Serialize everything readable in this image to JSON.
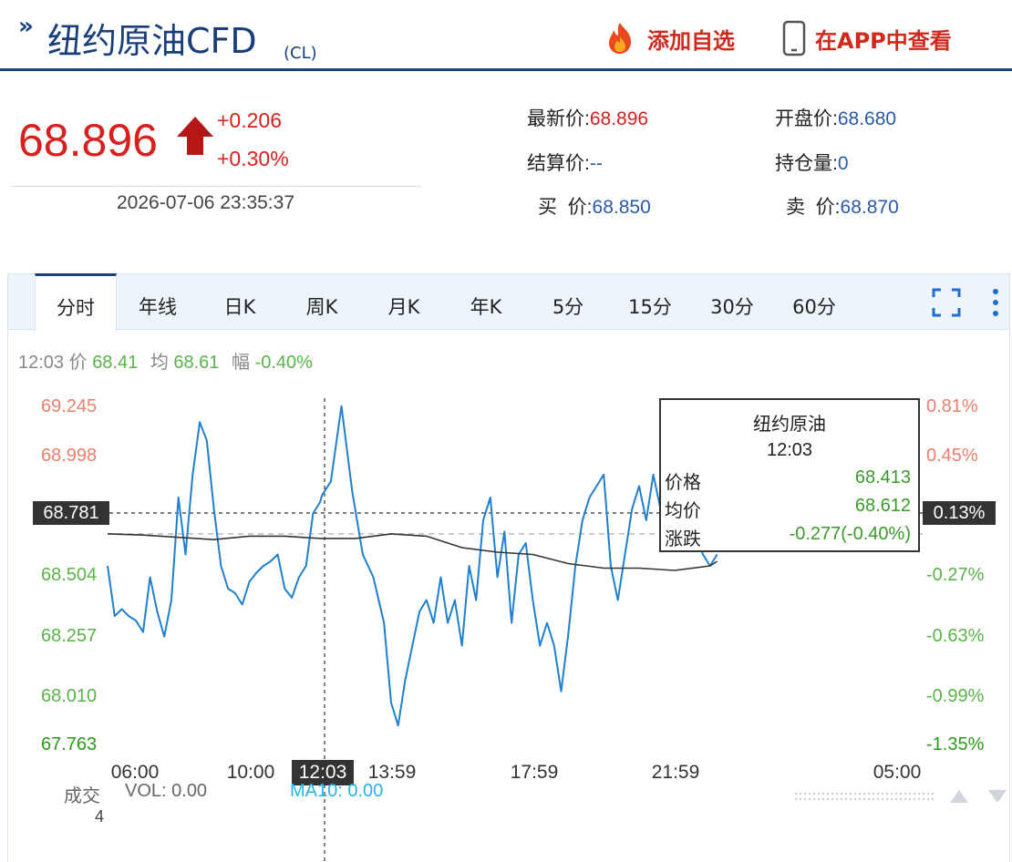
{
  "header": {
    "chevron": "»",
    "title": "纽约原油CFD",
    "code": "(CL)",
    "add_favorite_label": "添加自选",
    "view_in_app_label": "在APP中查看"
  },
  "quote": {
    "price": "68.896",
    "change": "+0.206",
    "change_pct": "+0.30%",
    "datetime": "2026-07-06 23:35:37",
    "fields": [
      {
        "key": "最新价:",
        "value": "68.896",
        "highlight": true
      },
      {
        "key": "开盘价:",
        "value": "68.680"
      },
      {
        "key": "结算价:",
        "value": "--"
      },
      {
        "key": "持仓量:",
        "value": "0"
      },
      {
        "key": "买  价:",
        "value": "68.850"
      },
      {
        "key": "卖  价:",
        "value": "68.870"
      }
    ]
  },
  "tabs": [
    "分时",
    "年线",
    "日K",
    "周K",
    "月K",
    "年K",
    "5分",
    "15分",
    "30分",
    "60分"
  ],
  "active_tab": "分时",
  "infoline": {
    "time": "12:03",
    "price_key": "价",
    "price": "68.41",
    "avg_key": "均",
    "avg": "68.61",
    "amp_key": "幅",
    "amp": "-0.40%"
  },
  "tooltip": {
    "title": "纽约原油",
    "time": "12:03",
    "rows": [
      {
        "key": "价格",
        "value": "68.413"
      },
      {
        "key": "均价",
        "value": "68.612"
      },
      {
        "key": "涨跌",
        "value": "-0.277(-0.40%)"
      }
    ]
  },
  "cursor": {
    "x_label": "12:03",
    "y_label": "68.781",
    "y_pct_label": "0.13%"
  },
  "volume": {
    "label": "成交",
    "vol_text": "VOL: 0.00",
    "ma_text": "MA10: 0.00",
    "count": "4"
  },
  "colors": {
    "up": "#d8201e",
    "down": "#3a9a2a",
    "line": "#1f7fd0",
    "avg": "#333333",
    "brand": "#1a3e7a"
  },
  "chart_data": {
    "type": "line",
    "y_ticks_left": [
      "69.245",
      "68.998",
      "68.504",
      "68.257",
      "68.010",
      "67.763"
    ],
    "y_ticks_right": [
      "0.81%",
      "0.45%",
      "-0.27%",
      "-0.63%",
      "-0.99%",
      "-1.35%"
    ],
    "x_ticks": [
      "06:00",
      "10:00",
      "13:59",
      "17:59",
      "21:59",
      "05:00"
    ],
    "ylim": [
      67.763,
      69.245
    ],
    "reference_price": 68.69,
    "x_range_hours": [
      6,
      29
    ],
    "series": [
      {
        "x": [
          6.0,
          6.2,
          6.4,
          6.6,
          6.8,
          7.0,
          7.2,
          7.4,
          7.6,
          7.8,
          8.0,
          8.2,
          8.4,
          8.6,
          8.8,
          9.0,
          9.2,
          9.4,
          9.6,
          9.8,
          10.0,
          10.2,
          10.4,
          10.6,
          10.8,
          11.0,
          11.2,
          11.4,
          11.6,
          11.8,
          12.0,
          12.05,
          12.3,
          12.6,
          12.9,
          13.2,
          13.5,
          13.8,
          14.0,
          14.2,
          14.4,
          14.6,
          14.8,
          15.0,
          15.2,
          15.4,
          15.6,
          15.8,
          16.0,
          16.2,
          16.4,
          16.6,
          16.8,
          17.0,
          17.2,
          17.4,
          17.6,
          17.8,
          18.0,
          18.2,
          18.4,
          18.6,
          18.8,
          19.0,
          19.2,
          19.4,
          19.6,
          19.8,
          20.0,
          20.2,
          20.4,
          20.6,
          20.8,
          21.0,
          21.2,
          21.4,
          21.6,
          21.8,
          22.0,
          22.2,
          22.4,
          22.6,
          22.8,
          23.0,
          23.2
        ],
        "y": [
          68.55,
          68.33,
          68.36,
          68.33,
          68.31,
          68.26,
          68.5,
          68.35,
          68.24,
          68.4,
          68.85,
          68.6,
          68.95,
          69.18,
          69.1,
          68.8,
          68.55,
          68.45,
          68.43,
          68.38,
          68.48,
          68.52,
          68.55,
          68.57,
          68.6,
          68.45,
          68.41,
          68.5,
          68.55,
          68.78,
          68.83,
          68.86,
          68.92,
          69.25,
          68.88,
          68.6,
          68.5,
          68.3,
          67.95,
          67.85,
          68.05,
          68.2,
          68.35,
          68.4,
          68.3,
          68.5,
          68.3,
          68.4,
          68.2,
          68.55,
          68.4,
          68.75,
          68.85,
          68.5,
          68.7,
          68.3,
          68.6,
          68.65,
          68.4,
          68.2,
          68.3,
          68.2,
          68.0,
          68.25,
          68.55,
          68.75,
          68.85,
          68.9,
          68.95,
          68.55,
          68.4,
          68.6,
          68.8,
          68.9,
          68.75,
          68.95,
          68.8,
          68.85,
          68.9,
          68.95,
          68.8,
          68.7,
          68.6,
          68.55,
          68.6
        ],
        "name": ""
      },
      {
        "x": [
          6.0,
          7.0,
          8.0,
          9.0,
          10.0,
          11.0,
          12.0,
          13.0,
          14.0,
          15.0,
          16.0,
          17.0,
          18.0,
          19.0,
          20.0,
          21.0,
          22.0,
          23.0,
          23.2
        ],
        "y": [
          68.69,
          68.685,
          68.675,
          68.665,
          68.68,
          68.68,
          68.67,
          68.67,
          68.69,
          68.68,
          68.63,
          68.61,
          68.6,
          68.56,
          68.54,
          68.54,
          68.53,
          68.55,
          68.57
        ],
        "name": ""
      }
    ]
  }
}
